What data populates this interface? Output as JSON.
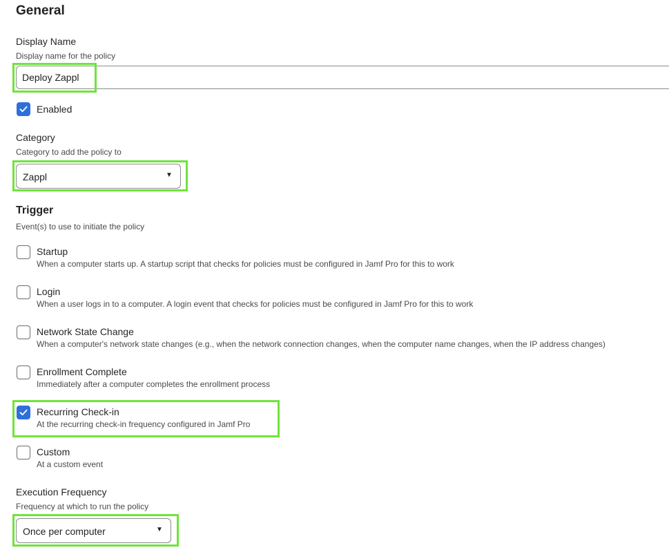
{
  "general": {
    "title": "General",
    "display_name": {
      "label": "Display Name",
      "help": "Display name for the policy",
      "value": "Deploy Zappl"
    },
    "enabled": {
      "label": "Enabled",
      "checked": true
    },
    "category": {
      "label": "Category",
      "help": "Category to add the policy to",
      "selected": "Zappl"
    },
    "trigger": {
      "title": "Trigger",
      "help": "Event(s) to use to initiate the policy",
      "options": [
        {
          "label": "Startup",
          "desc": "When a computer starts up. A startup script that checks for policies must be configured in Jamf Pro for this to work",
          "checked": false
        },
        {
          "label": "Login",
          "desc": "When a user logs in to a computer. A login event that checks for policies must be configured in Jamf Pro for this to work",
          "checked": false
        },
        {
          "label": "Network State Change",
          "desc": "When a computer's network state changes (e.g., when the network connection changes, when the computer name changes, when the IP address changes)",
          "checked": false
        },
        {
          "label": "Enrollment Complete",
          "desc": "Immediately after a computer completes the enrollment process",
          "checked": false
        },
        {
          "label": "Recurring Check-in",
          "desc": "At the recurring check-in frequency configured in Jamf Pro",
          "checked": true
        },
        {
          "label": "Custom",
          "desc": "At a custom event",
          "checked": false
        }
      ]
    },
    "execution_frequency": {
      "label": "Execution Frequency",
      "help": "Frequency at which to run the policy",
      "selected": "Once per computer"
    }
  },
  "colors": {
    "highlight": "#6ee43b",
    "checkbox_checked": "#2f6fdc"
  },
  "icons": {
    "checkmark": "check-icon",
    "dropdown": "caret-down-icon"
  }
}
